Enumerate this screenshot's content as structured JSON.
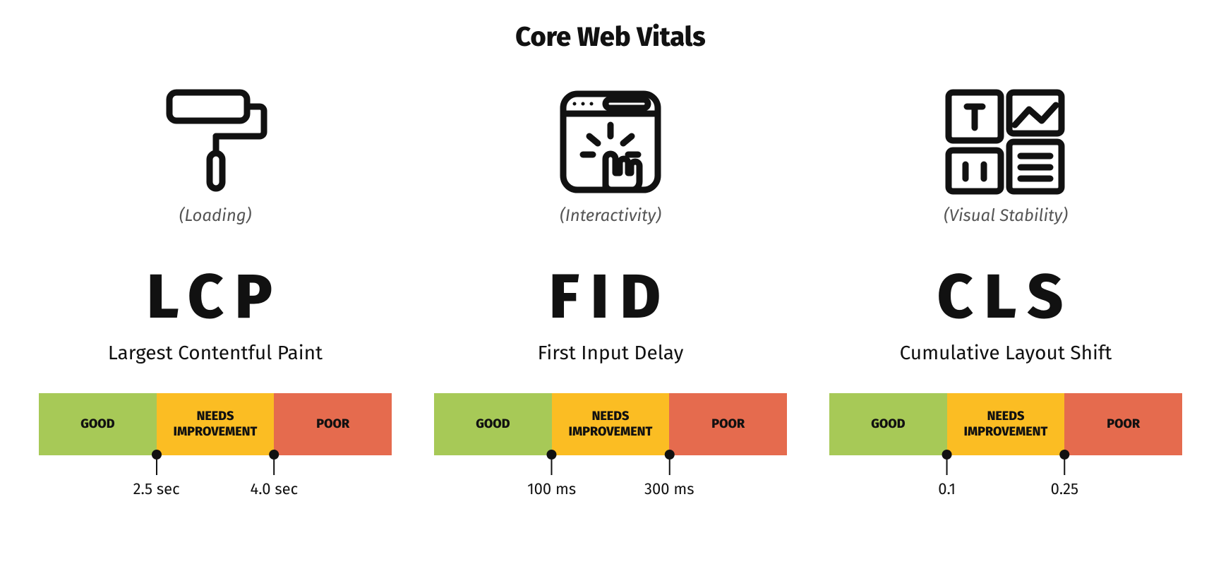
{
  "title": "Core Web Vitals",
  "labels": {
    "good": "GOOD",
    "needs": "NEEDS IMPROVEMENT",
    "poor": "POOR"
  },
  "metrics": [
    {
      "caption": "(Loading)",
      "abbr": "LCP",
      "full": "Largest Contentful Paint",
      "thresholds": [
        "2.5 sec",
        "4.0 sec"
      ]
    },
    {
      "caption": "(Interactivity)",
      "abbr": "FID",
      "full": "First Input Delay",
      "thresholds": [
        "100 ms",
        "300 ms"
      ]
    },
    {
      "caption": "(Visual Stability)",
      "abbr": "CLS",
      "full": "Cumulative Layout Shift",
      "thresholds": [
        "0.1",
        "0.25"
      ]
    }
  ]
}
